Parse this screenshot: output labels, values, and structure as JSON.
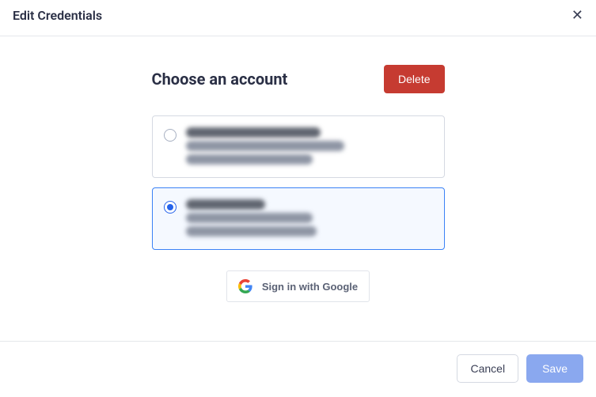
{
  "header": {
    "title": "Edit Credentials"
  },
  "section": {
    "title": "Choose an account",
    "delete_label": "Delete"
  },
  "accounts": [
    {
      "selected": false,
      "name": "Polur Sai Sankeerth Rao",
      "email": "sankeerth@rudderstack.com",
      "created": "Created at 28 Nov 2022"
    },
    {
      "selected": true,
      "name": "Isha Chopra",
      "email": "isha@rudderstack.com",
      "created": "Created at 30 Nov 2022"
    }
  ],
  "google_signin": {
    "label": "Sign in with Google"
  },
  "footer": {
    "cancel_label": "Cancel",
    "save_label": "Save"
  }
}
